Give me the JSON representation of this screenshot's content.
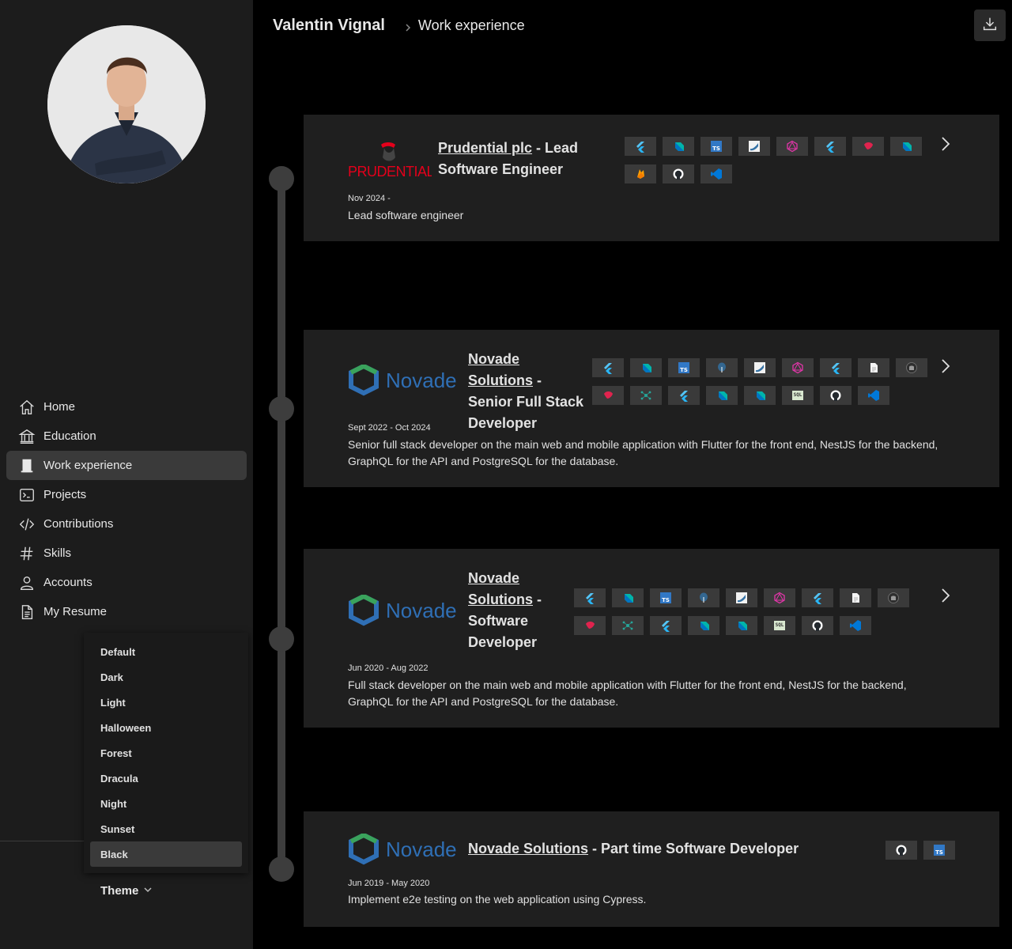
{
  "header": {
    "name": "Valentin Vignal",
    "page": "Work experience"
  },
  "nav": [
    {
      "id": "home",
      "label": "Home",
      "icon": "home-icon"
    },
    {
      "id": "education",
      "label": "Education",
      "icon": "bank-icon"
    },
    {
      "id": "work",
      "label": "Work experience",
      "icon": "building-icon",
      "active": true
    },
    {
      "id": "projects",
      "label": "Projects",
      "icon": "terminal-icon"
    },
    {
      "id": "contributions",
      "label": "Contributions",
      "icon": "code-icon"
    },
    {
      "id": "skills",
      "label": "Skills",
      "icon": "hashtag-icon"
    },
    {
      "id": "accounts",
      "label": "Accounts",
      "icon": "person-icon"
    },
    {
      "id": "resume",
      "label": "My Resume",
      "icon": "document-icon"
    }
  ],
  "theme": {
    "label": "Theme",
    "options": [
      "Default",
      "Dark",
      "Light",
      "Halloween",
      "Forest",
      "Dracula",
      "Night",
      "Sunset",
      "Black"
    ],
    "selected": "Black"
  },
  "experiences": [
    {
      "company": "Prudential plc",
      "role": "Lead Software Engineer",
      "logo": "PRUDENTIAL",
      "dates": "Nov 2024 -",
      "description": "Lead software engineer",
      "skills": [
        "flutter-icon",
        "dart-icon",
        "typescript-icon",
        "python-icon",
        "graphql-icon",
        "flutter-icon",
        "nestjs-icon",
        "dart-icon",
        "firebase-icon",
        "github-icon",
        "vscode-icon"
      ]
    },
    {
      "company": "Novade Solutions",
      "role": "Senior Full Stack Developer",
      "logo": "Novade",
      "dates": "Sept 2022 - Oct 2024",
      "description": "Senior full stack developer on the main web and mobile application with Flutter for the front end, NestJS for the backend, GraphQL for the API and PostgreSQL for the database.",
      "skills": [
        "flutter-icon",
        "dart-icon",
        "typescript-icon",
        "postgresql-icon",
        "python-icon",
        "graphql-icon",
        "flutter-icon",
        "document-icon",
        "cypress-icon",
        "nestjs-icon",
        "network-icon",
        "flutter-icon",
        "dart-icon",
        "dart-icon",
        "sql-icon",
        "github-icon",
        "vscode-icon"
      ]
    },
    {
      "company": "Novade Solutions",
      "role": "Software Developer",
      "logo": "Novade",
      "dates": "Jun 2020 - Aug 2022",
      "description": "Full stack developer on the main web and mobile application with Flutter for the front end, NestJS for the backend, GraphQL for the API and PostgreSQL for the database.",
      "skills": [
        "flutter-icon",
        "dart-icon",
        "typescript-icon",
        "postgresql-icon",
        "python-icon",
        "graphql-icon",
        "flutter-icon",
        "document-icon",
        "cypress-icon",
        "nestjs-icon",
        "network-icon",
        "flutter-icon",
        "dart-icon",
        "dart-icon",
        "sql-icon",
        "github-icon",
        "vscode-icon"
      ]
    },
    {
      "company": "Novade Solutions",
      "role": "Part time Software Developer",
      "logo": "Novade",
      "dates": "Jun 2019 - May 2020",
      "description": "Implement e2e testing on the web application using Cypress.",
      "skills": [
        "github-icon",
        "typescript-icon"
      ]
    }
  ],
  "colors": {
    "sidebar": "#1c1c1c",
    "card": "#1f1f1f",
    "skill_bg": "#3a3a3a",
    "accent_blue": "#2f6fb5",
    "novade_green": "#3aa35c",
    "prudential_red": "#e3001b"
  }
}
